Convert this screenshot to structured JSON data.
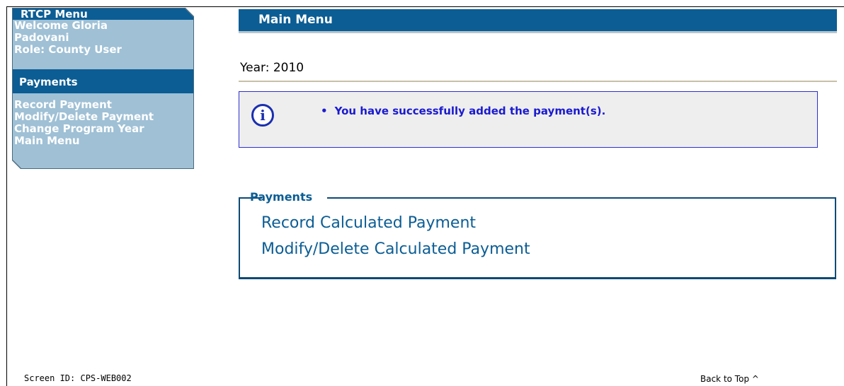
{
  "left_menu": {
    "title": "RTCP Menu",
    "welcome_line1": "Welcome Gloria",
    "welcome_line2": "Padovani",
    "role": "Role: County User",
    "section_title": "Payments",
    "items": [
      {
        "label": "Record Payment"
      },
      {
        "label": "Modify/Delete Payment"
      },
      {
        "label": "Change Program Year"
      },
      {
        "label": "Main Menu"
      }
    ]
  },
  "main": {
    "title": "Main Menu",
    "year_label": "Year:",
    "year_value": "2010",
    "message": {
      "icon": "info-icon",
      "bullet": "•",
      "text": "You have successfully added the payment(s)."
    },
    "payments": {
      "legend": "Payments",
      "links": [
        {
          "label": "Record Calculated Payment"
        },
        {
          "label": "Modify/Delete Calculated Payment"
        }
      ]
    }
  },
  "footer": {
    "screen_id": "Screen ID: CPS-WEB002",
    "back_to_top": "Back to Top ^"
  },
  "colors": {
    "header_blue": "#0b5d94",
    "menu_bg": "#9fc0d5",
    "message_text": "#1a1ad0",
    "message_border": "#2f2fd0"
  }
}
